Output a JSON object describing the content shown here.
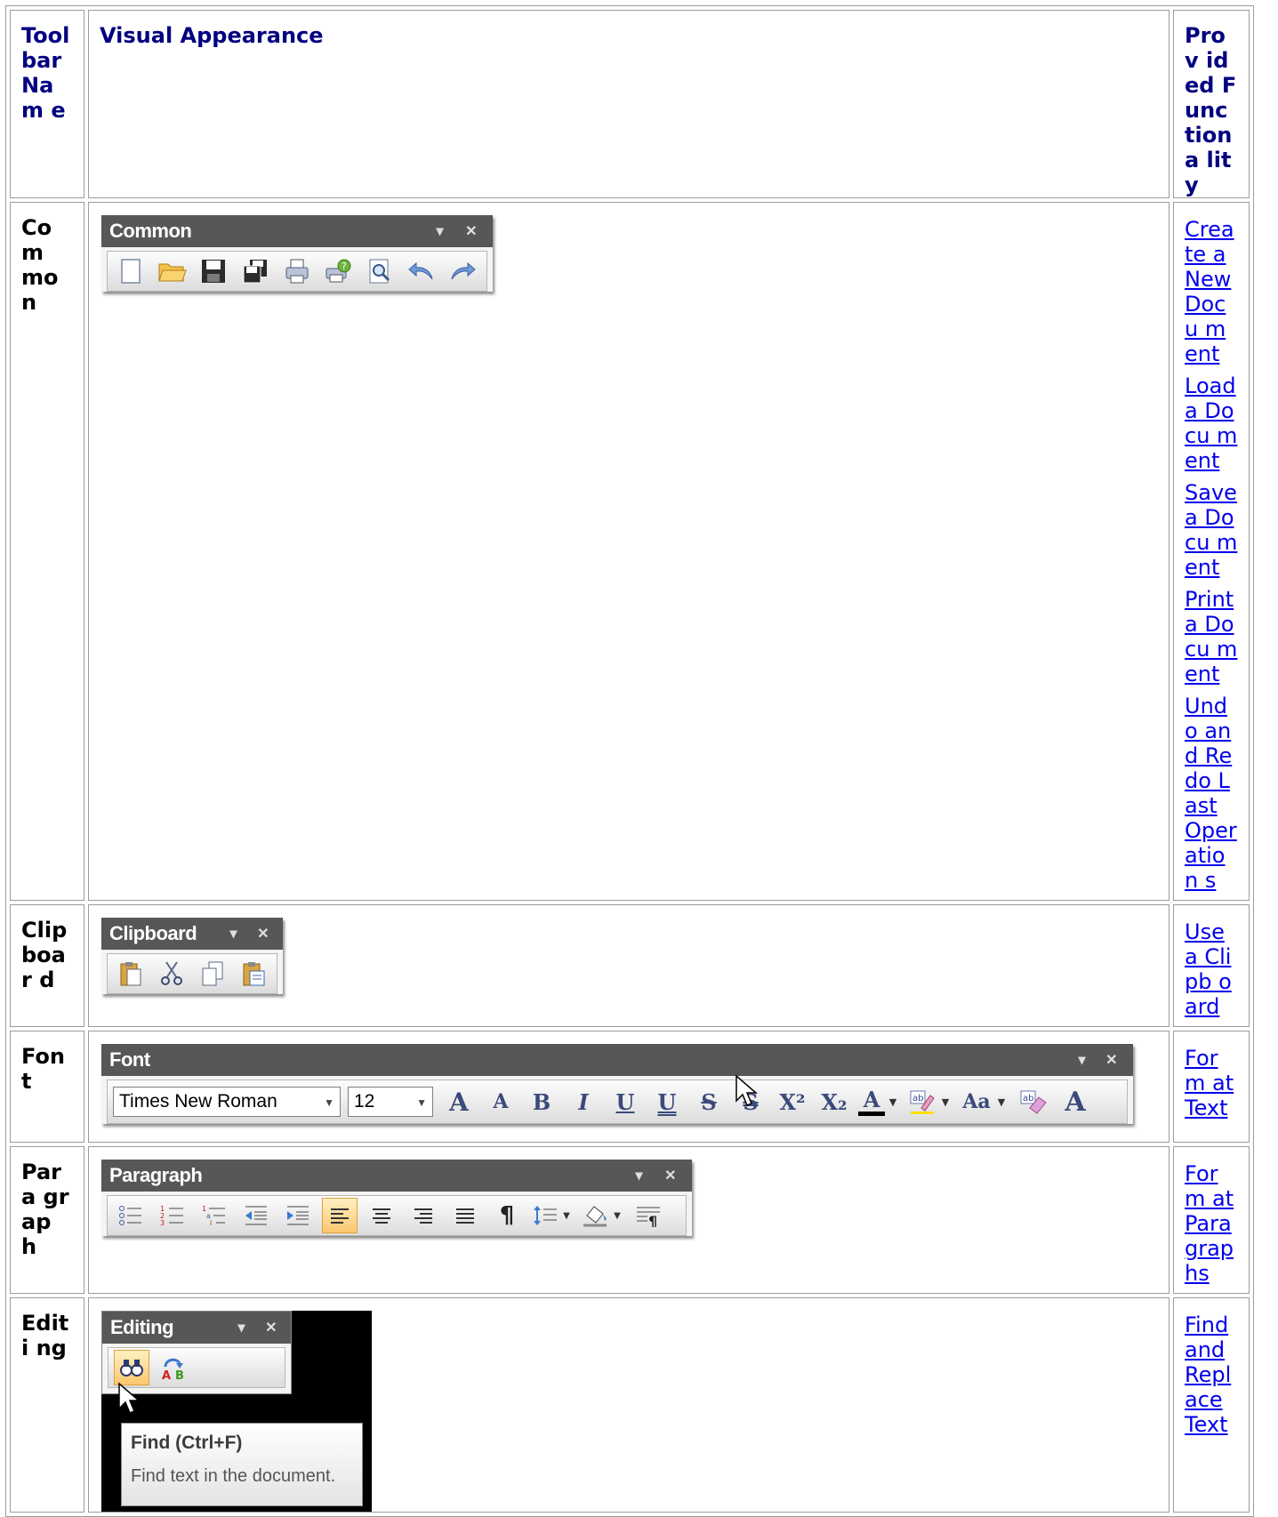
{
  "headers": [
    "Tool bar Nam e",
    "Visual Appearance",
    "Prov ided Func tiona lity"
  ],
  "rows": {
    "common": {
      "name": "Com mon",
      "toolbar_title": "Common",
      "icons": [
        "new-document",
        "open-folder",
        "save",
        "save-all",
        "print",
        "print-preview-help",
        "print-preview",
        "undo",
        "redo"
      ],
      "links": [
        "Crea te a New Docu ment",
        "Load a Docu ment",
        "Save a Docu ment",
        "Print a Docu ment",
        "Undo and Redo Last Oper ation s"
      ]
    },
    "clipboard": {
      "name": "Clip boar d",
      "toolbar_title": "Clipboard",
      "icons": [
        "paste",
        "cut",
        "copy",
        "paste-special"
      ],
      "links": [
        "Use a Clipb oard"
      ]
    },
    "font": {
      "name": "Font",
      "toolbar_title": "Font",
      "font_name": "Times New Roman",
      "font_size": "12",
      "buttons": [
        "A",
        "A",
        "B",
        "I",
        "U",
        "U",
        "S",
        "S",
        "X²",
        "X₂",
        "A",
        "Aa",
        "A"
      ],
      "links": [
        "Form at Text"
      ]
    },
    "paragraph": {
      "name": "Para grap h",
      "toolbar_title": "Paragraph",
      "links": [
        "Form at Para grap hs"
      ]
    },
    "editing": {
      "name": "Editi ng",
      "toolbar_title": "Editing",
      "tooltip_title": "Find (Ctrl+F)",
      "tooltip_text": "Find text in the document.",
      "links": [
        "Find and Repl ace Text"
      ]
    }
  },
  "colors": {
    "header_text": "#000080",
    "link": "#0000ee",
    "toolbar_title_bg": "#575757",
    "selected": "#fbc66e"
  }
}
